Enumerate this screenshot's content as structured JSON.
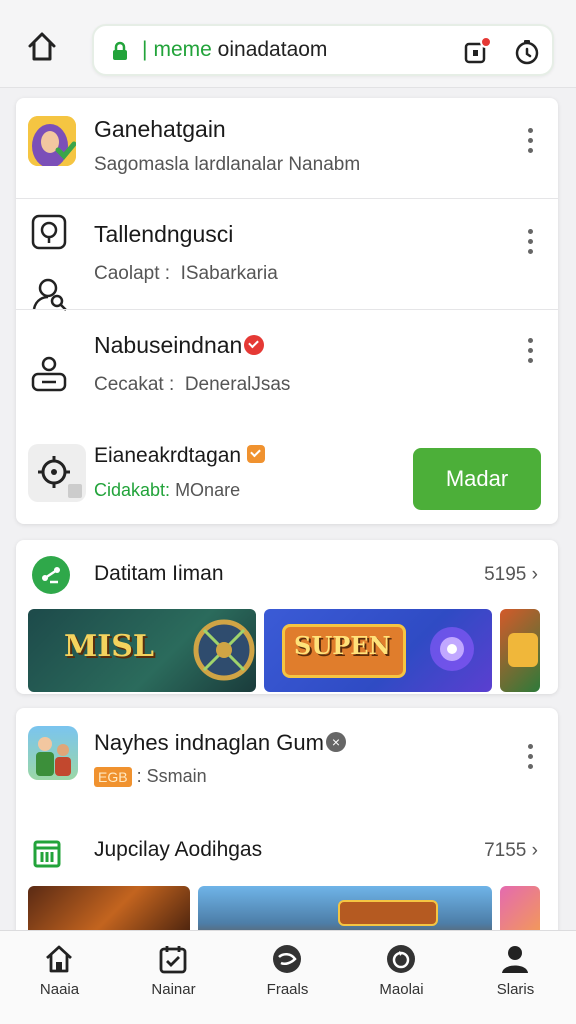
{
  "browser": {
    "url_prefix": "|",
    "url_highlight": "meme",
    "url_rest": "oinadataom"
  },
  "list": {
    "items": [
      {
        "title": "Ganehatgain",
        "subtitle": "Sagomasla lardlanalar Nanabm"
      },
      {
        "title": "Tallendngusci",
        "subtitle_key": "Caolapt :",
        "subtitle_val": "ISabarkaria"
      },
      {
        "title": "Nabuseindnan",
        "subtitle_key": "Cecakat :",
        "subtitle_val": "DeneralJsas"
      },
      {
        "title": "Eianeakrdtagan",
        "subtitle_key": "Cidakabt:",
        "subtitle_val": "MOnare"
      }
    ],
    "action_label": "Madar"
  },
  "section1": {
    "title": "Datitam Iiman",
    "count": "5195",
    "thumbs": [
      "MISL",
      "SUPEN"
    ]
  },
  "section2": {
    "app_title": "Nayhes indnaglan Gum",
    "app_tag": "EGB",
    "app_meta": ": Ssmain",
    "sub_title": "Jupcilay Aodihgas",
    "count": "7155"
  },
  "nav": {
    "items": [
      {
        "label": "Naaia",
        "icon": "home-icon"
      },
      {
        "label": "Nainar",
        "icon": "calendar-check-icon"
      },
      {
        "label": "Fraals",
        "icon": "games-icon"
      },
      {
        "label": "Maolai",
        "icon": "circle-refresh-icon"
      },
      {
        "label": "Slaris",
        "icon": "person-icon"
      }
    ]
  },
  "colors": {
    "accent_green": "#4caf39",
    "link_green": "#22a33a",
    "badge_red": "#e53935",
    "badge_orange": "#f0922f"
  }
}
